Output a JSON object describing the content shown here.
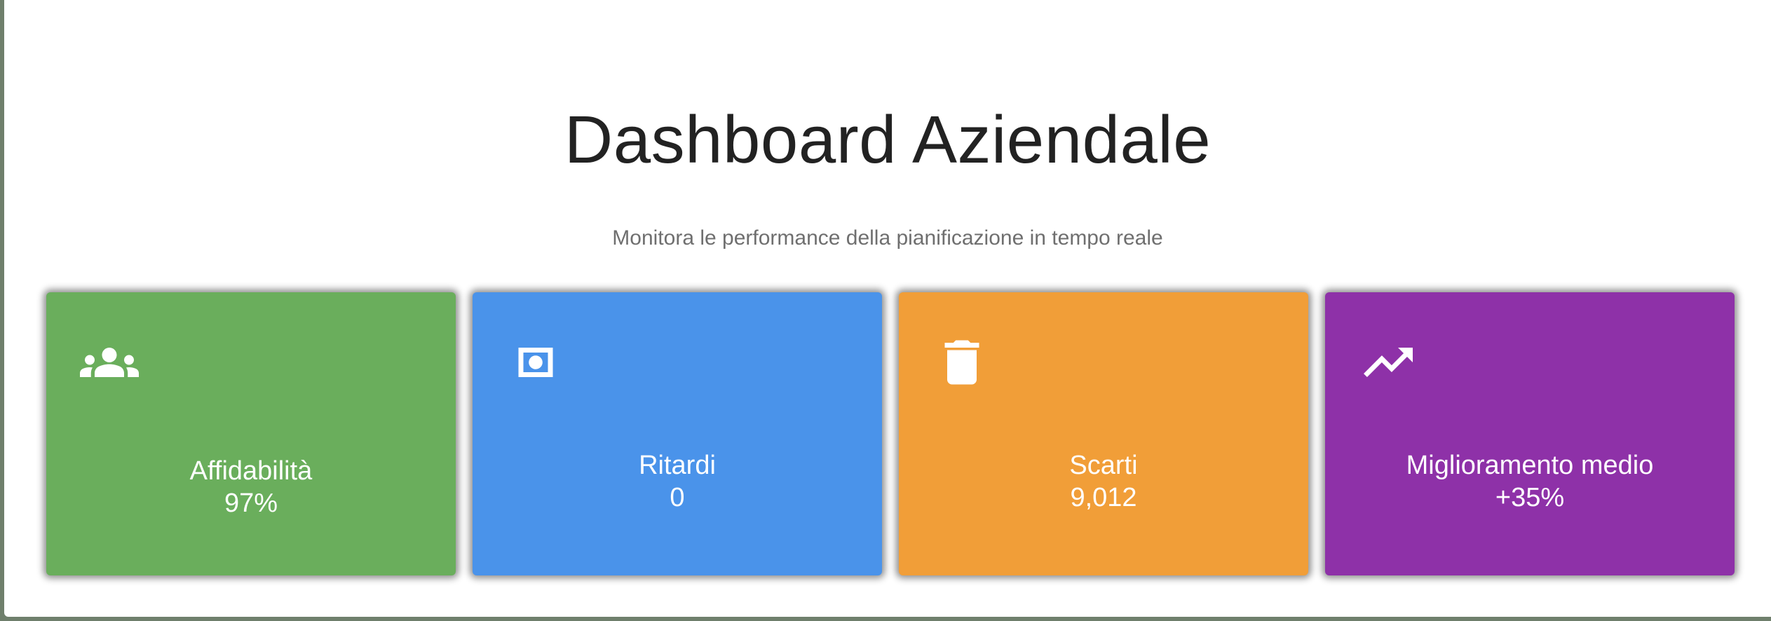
{
  "header": {
    "title": "Dashboard Aziendale",
    "subtitle": "Monitora le performance della pianificazione in tempo reale"
  },
  "cards": [
    {
      "label": "Affidabilità",
      "value": "97%",
      "icon": "group-icon",
      "color": "#6aae5c"
    },
    {
      "label": "Ritardi",
      "value": "0",
      "icon": "money-icon",
      "color": "#4a93ea"
    },
    {
      "label": "Scarti",
      "value": "9,012",
      "icon": "trash-icon",
      "color": "#f19e38"
    },
    {
      "label": "Miglioramento medio",
      "value": "+35%",
      "icon": "trending-up-icon",
      "color": "#8e31a8"
    }
  ]
}
